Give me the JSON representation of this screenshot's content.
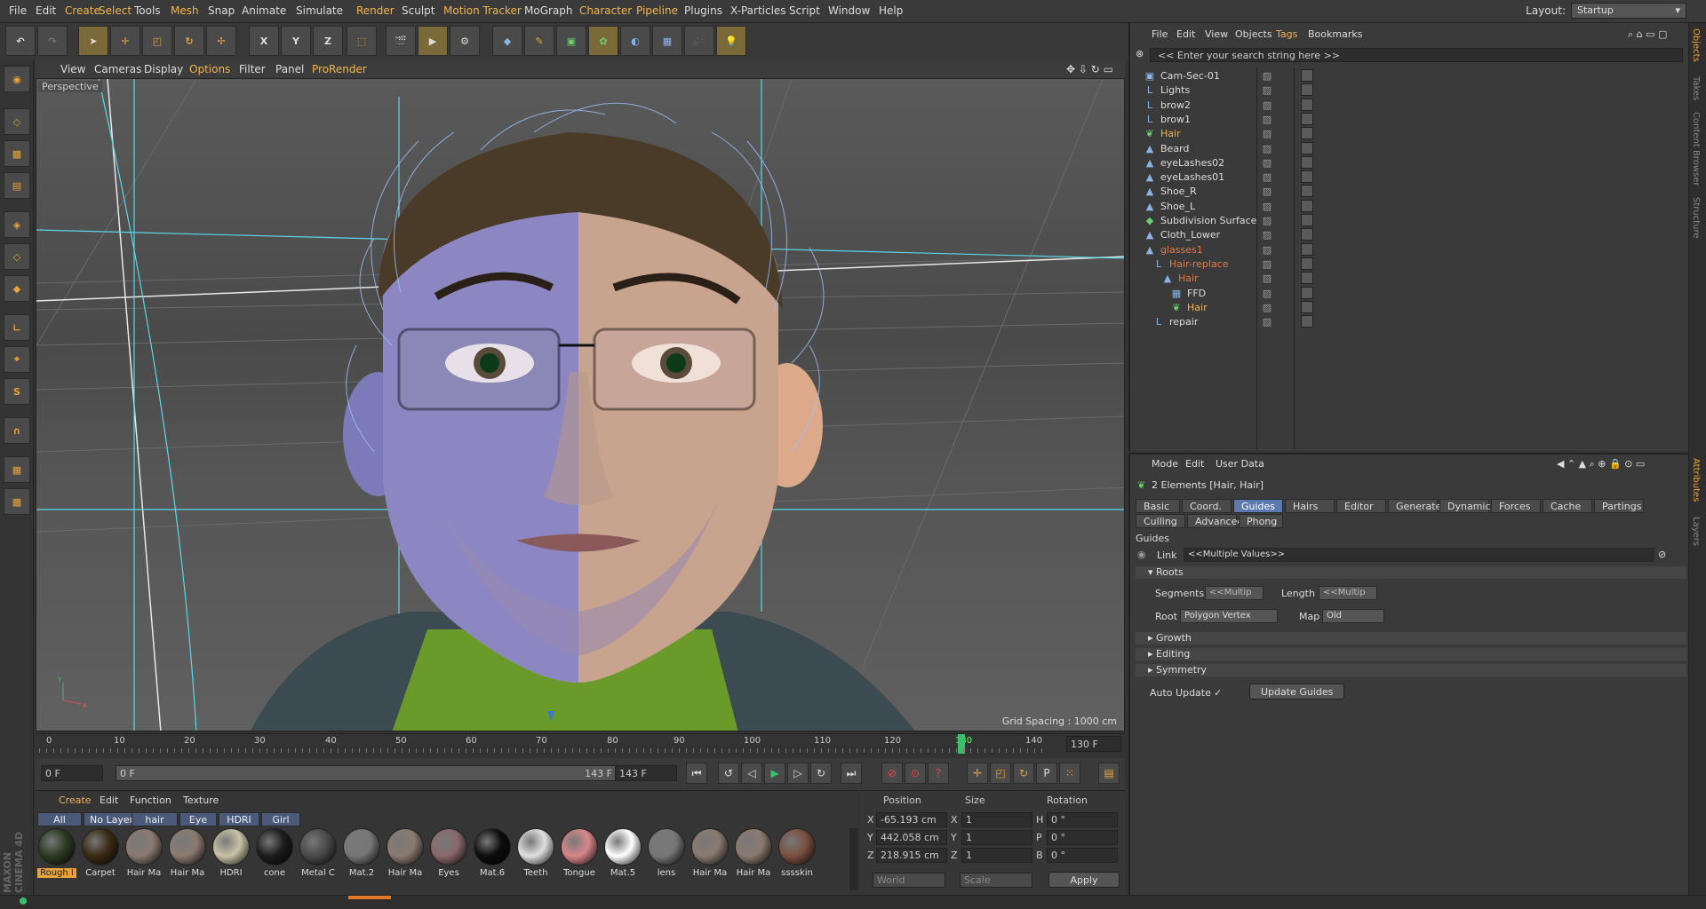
{
  "menubar": {
    "items": [
      "File",
      "Edit",
      "Create",
      "Select",
      "Tools",
      "Mesh",
      "Snap",
      "Animate",
      "Simulate",
      "Render",
      "Sculpt",
      "Motion Tracker",
      "MoGraph",
      "Character",
      "Pipeline",
      "Plugins",
      "X-Particles",
      "Script",
      "Window",
      "Help"
    ],
    "highlighted": [
      "Create",
      "Select",
      "Mesh",
      "Render",
      "Motion Tracker",
      "Character",
      "Pipeline"
    ],
    "layout_label": "Layout:",
    "layout_value": "Startup"
  },
  "toolbar": {
    "axis_buttons": [
      "X",
      "Y",
      "Z"
    ]
  },
  "viewport": {
    "menu": [
      "View",
      "Cameras",
      "Display",
      "Options",
      "Filter",
      "Panel",
      "ProRender"
    ],
    "highlighted": [
      "Options",
      "ProRender"
    ],
    "label": "Perspective",
    "grid_spacing": "Grid Spacing : 1000 cm",
    "axis_y": "y",
    "axis_x": "x"
  },
  "timeline": {
    "ticks": [
      "0",
      "10",
      "20",
      "30",
      "40",
      "50",
      "60",
      "70",
      "80",
      "90",
      "100",
      "110",
      "120",
      "130",
      "140"
    ],
    "current": "130",
    "end_field": "130 F"
  },
  "playback": {
    "start_field": "0 F",
    "range_start": "0 F",
    "range_end": "143 F",
    "end_field": "143 F"
  },
  "materials": {
    "menu": [
      "Create",
      "Edit",
      "Function",
      "Texture"
    ],
    "tabs": [
      "All",
      "No Layer",
      "hair",
      "Eye",
      "HDRI",
      "Girl"
    ],
    "items": [
      {
        "label": "Rough I",
        "color": "#2b3a22"
      },
      {
        "label": "Carpet",
        "color": "#3a2a14"
      },
      {
        "label": "Hair Ma",
        "color": "#8a7a70"
      },
      {
        "label": "Hair Ma",
        "color": "#8a7a70"
      },
      {
        "label": "HDRI",
        "color": "#c9c2a8"
      },
      {
        "label": "cone",
        "color": "#1c1c1c"
      },
      {
        "label": "Metal C",
        "color": "#4a4a4a"
      },
      {
        "label": "Mat.2",
        "color": "#777777"
      },
      {
        "label": "Hair Ma",
        "color": "#8a7a70"
      },
      {
        "label": "Eyes",
        "color": "#8a6a6a"
      },
      {
        "label": "Mat.6",
        "color": "#0d0d0d"
      },
      {
        "label": "Teeth",
        "color": "#e0e0e0"
      },
      {
        "label": "Tongue",
        "color": "#d9868a"
      },
      {
        "label": "Mat.5",
        "color": "#ffffff"
      },
      {
        "label": "lens",
        "color": "#777777"
      },
      {
        "label": "Hair Ma",
        "color": "#8a7a70"
      },
      {
        "label": "Hair Ma",
        "color": "#8a7a70"
      },
      {
        "label": "sssskin",
        "color": "#7a5040"
      }
    ]
  },
  "coords": {
    "headers": [
      "Position",
      "Size",
      "Rotation"
    ],
    "rows": [
      {
        "axis": "X",
        "pos": "-65.193 cm",
        "sizeaxis": "X",
        "size": "1",
        "rotaxis": "H",
        "rot": "0 °"
      },
      {
        "axis": "Y",
        "pos": "442.058 cm",
        "sizeaxis": "Y",
        "size": "1",
        "rotaxis": "P",
        "rot": "0 °"
      },
      {
        "axis": "Z",
        "pos": "218.915 cm",
        "sizeaxis": "Z",
        "size": "1",
        "rotaxis": "B",
        "rot": "0 °"
      }
    ],
    "world": "World",
    "scale": "Scale",
    "apply": "Apply"
  },
  "objects": {
    "menu": [
      "File",
      "Edit",
      "View",
      "Objects",
      "Tags",
      "Bookmarks"
    ],
    "search_placeholder": "<< Enter your search string here >>",
    "rows": [
      {
        "name": "Cam-Sec-01",
        "indent": 0,
        "style": "normal",
        "icon": "camera-icon"
      },
      {
        "name": "Lights",
        "indent": 0,
        "style": "normal",
        "icon": "null-icon"
      },
      {
        "name": "brow2",
        "indent": 0,
        "style": "normal",
        "icon": "null-icon"
      },
      {
        "name": "brow1",
        "indent": 0,
        "style": "normal",
        "icon": "null-icon"
      },
      {
        "name": "Hair",
        "indent": 0,
        "style": "hl",
        "icon": "hair-icon"
      },
      {
        "name": "Beard",
        "indent": 0,
        "style": "normal",
        "icon": "polygon-icon"
      },
      {
        "name": "eyeLashes02",
        "indent": 0,
        "style": "normal",
        "icon": "polygon-icon"
      },
      {
        "name": "eyeLashes01",
        "indent": 0,
        "style": "normal",
        "icon": "polygon-icon"
      },
      {
        "name": "Shoe_R",
        "indent": 0,
        "style": "normal",
        "icon": "polygon-icon"
      },
      {
        "name": "Shoe_L",
        "indent": 0,
        "style": "normal",
        "icon": "polygon-icon"
      },
      {
        "name": "Subdivision Surface",
        "indent": 0,
        "style": "normal",
        "icon": "subdiv-icon"
      },
      {
        "name": "Cloth_Lower",
        "indent": 0,
        "style": "normal",
        "icon": "polygon-icon"
      },
      {
        "name": "glasses1",
        "indent": 0,
        "style": "red",
        "icon": "polygon-icon"
      },
      {
        "name": "Hair-replace",
        "indent": 1,
        "style": "red",
        "icon": "null-icon"
      },
      {
        "name": "Hair",
        "indent": 2,
        "style": "red",
        "icon": "polygon-icon"
      },
      {
        "name": "FFD",
        "indent": 3,
        "style": "normal",
        "icon": "ffd-icon"
      },
      {
        "name": "Hair",
        "indent": 3,
        "style": "hl",
        "icon": "hair-icon"
      },
      {
        "name": "repair",
        "indent": 1,
        "style": "normal",
        "icon": "null-icon"
      }
    ]
  },
  "attributes": {
    "menu": [
      "Mode",
      "Edit",
      "User Data"
    ],
    "title": "2 Elements [Hair, Hair]",
    "tabs_row1": [
      "Basic",
      "Coord.",
      "Guides",
      "Hairs",
      "Editor",
      "Generate",
      "Dynamics",
      "Forces",
      "Cache",
      "Partings"
    ],
    "tabs_row2": [
      "Culling",
      "Advanced",
      "Phong"
    ],
    "active_tab": "Guides",
    "section": "Guides",
    "link_label": "Link",
    "link_value": "<<Multiple Values>>",
    "roots": "Roots",
    "segments_label": "Segments",
    "segments_value": "<<Multip",
    "length_label": "Length",
    "length_value": "<<Multip",
    "root_label": "Root",
    "root_value": "Polygon Vertex",
    "map_label": "Map",
    "map_value": "Old",
    "subsections": [
      "Growth",
      "Editing",
      "Symmetry"
    ],
    "auto_update_label": "Auto Update",
    "auto_update_check": "✓",
    "update_button": "Update Guides"
  },
  "right_strip": [
    "Objects",
    "Takes",
    "Content Browser",
    "Structure",
    "Attributes",
    "Layers"
  ],
  "maxon": "MAXON CINEMA 4D"
}
